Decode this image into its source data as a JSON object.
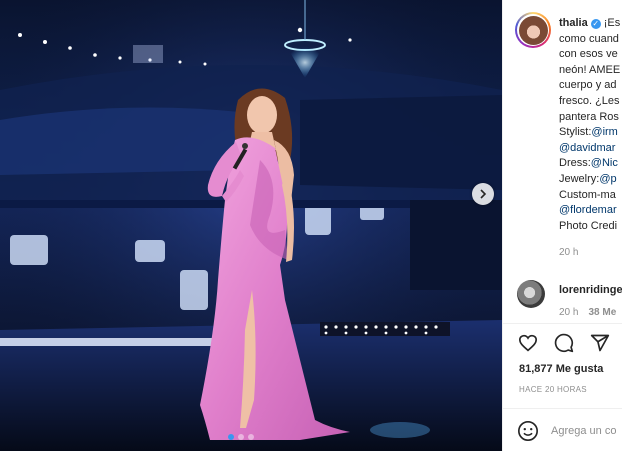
{
  "post": {
    "username": "thalia",
    "verified_mark": "✓",
    "caption_lines": [
      "¡Es",
      "como cuand",
      "con esos ve",
      "neón! AMEE",
      "cuerpo y ad",
      "fresco. ¿Les",
      "pantera Ros"
    ],
    "credits": [
      {
        "label": "Stylist: ",
        "handle": "@irm"
      },
      {
        "label": "",
        "handle": "@davidmar"
      },
      {
        "label": "Dress: ",
        "handle": "@Nic"
      },
      {
        "label": "Jewelry: ",
        "handle": "@p"
      },
      {
        "label": "Custom-ma",
        "handle": ""
      },
      {
        "label": "",
        "handle": "@flordemar"
      },
      {
        "label": "Photo Credi",
        "handle": ""
      }
    ],
    "time_ago": "20 h"
  },
  "comment": {
    "username": "lorenridinge",
    "time": "20 h",
    "likes": "38 Me"
  },
  "actions": {
    "like_icon": "heart-icon",
    "comment_icon": "comment-icon",
    "share_icon": "share-icon"
  },
  "likes_text": "81,877 Me gusta",
  "timestamp_text": "HACE 20 HORAS",
  "comment_input": {
    "placeholder": "Agrega un co",
    "value": ""
  },
  "colors": {
    "link": "#00376b",
    "verified": "#3897f0",
    "dress": "#e58cd0",
    "stage_blue": "#14265a"
  },
  "carousel": {
    "next_icon": "chevron-right-icon",
    "total": 3,
    "active": 1
  }
}
